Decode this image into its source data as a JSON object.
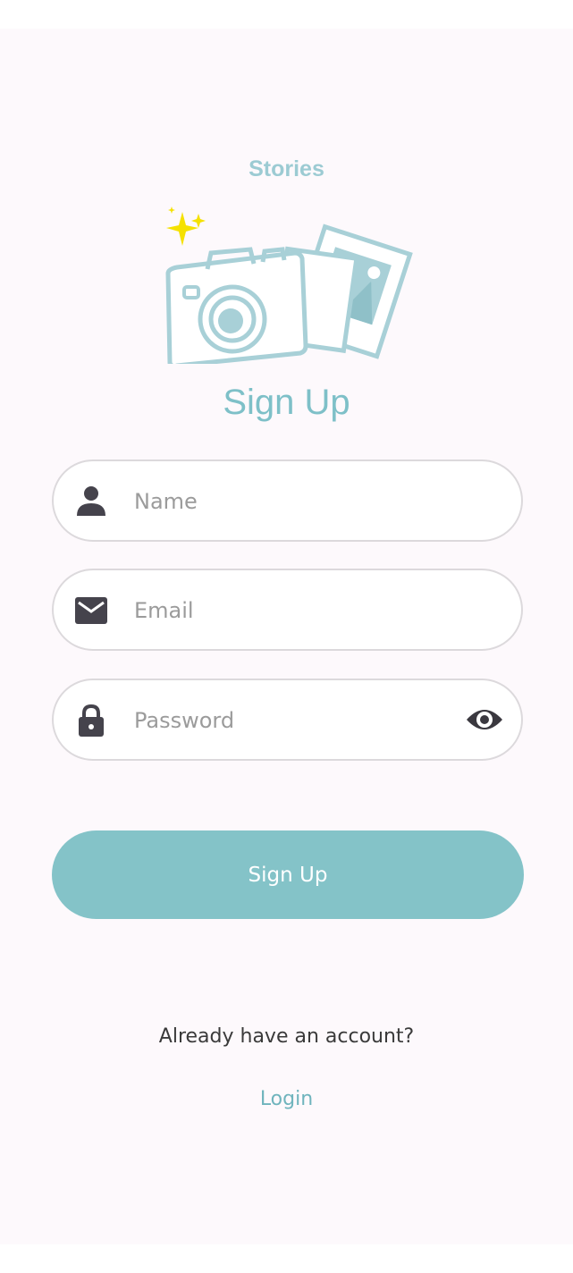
{
  "app": {
    "name": "Stories"
  },
  "page": {
    "title": "Sign Up"
  },
  "form": {
    "name_placeholder": "Name",
    "name_value": "",
    "email_placeholder": "Email",
    "email_value": "",
    "password_placeholder": "Password",
    "password_value": "",
    "name_icon": "person-icon",
    "email_icon": "mail-icon",
    "password_icon": "lock-icon",
    "visibility_icon": "eye-icon"
  },
  "actions": {
    "signup_label": "Sign Up",
    "already_text": "Already have an account?",
    "login_label": "Login"
  },
  "colors": {
    "accent": "#84c3c8",
    "title": "#7ec0c8",
    "sparkle": "#f5e100",
    "icon": "#45434c",
    "background": "#fdf9fc"
  }
}
